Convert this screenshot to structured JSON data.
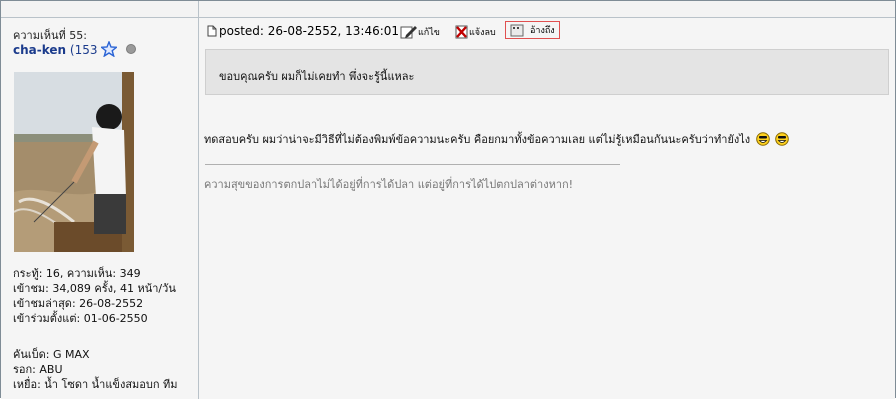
{
  "post": {
    "number_label": "ความเห็นที่ 55:",
    "posted": "posted: 26-08-2552, 13:46:01",
    "edit_label": "แก้ไข",
    "report_label": "แจ้งลบ",
    "quote_label": "อ้างถึง"
  },
  "user": {
    "name": "cha-ken",
    "count_open": "(153",
    "status": "offline"
  },
  "stats": {
    "threads": "กระทู้: 16, ความเห็น: 349",
    "visits": "เข้าชม: 34,089 ครั้ง, 41 หน้า/วัน",
    "last_visit": "เข้าชมล่าสุด: 26-08-2552",
    "joined": "เข้าร่วมตั้งแต่: 01-06-2550"
  },
  "gear": {
    "rod": "คันเบ็ด: G MAX",
    "reel": "รอก: ABU",
    "bait": "เหยื่อ: น้ำ โซดา น้ำแข็งสมอบก ทีม"
  },
  "quote": {
    "text": "ขอบคุณครับ ผมก็ไม่เคยทำ พึ่งจะรู้นี้แหละ"
  },
  "message": {
    "text": "ทดสอบครับ   ผมว่าน่าจะมีวิธีที่ไม่ต้องพิมพ์ข้อความนะครับ คือยกมาทั้งข้อความเลย แต่ไม่รู้เหมือนกันนะครับว่าทำยังไง"
  },
  "signature": {
    "text": "ความสุขของการตกปลาไม่ได้อยู่ที่การได้ปลา แต่อยู่ที่การได้ไปตกปลาต่างหาก!"
  },
  "colors": {
    "username": "#1b3b8c",
    "quote_bg": "#e4e4e4",
    "quote_button_border": "#e05050",
    "signature": "#777777"
  }
}
